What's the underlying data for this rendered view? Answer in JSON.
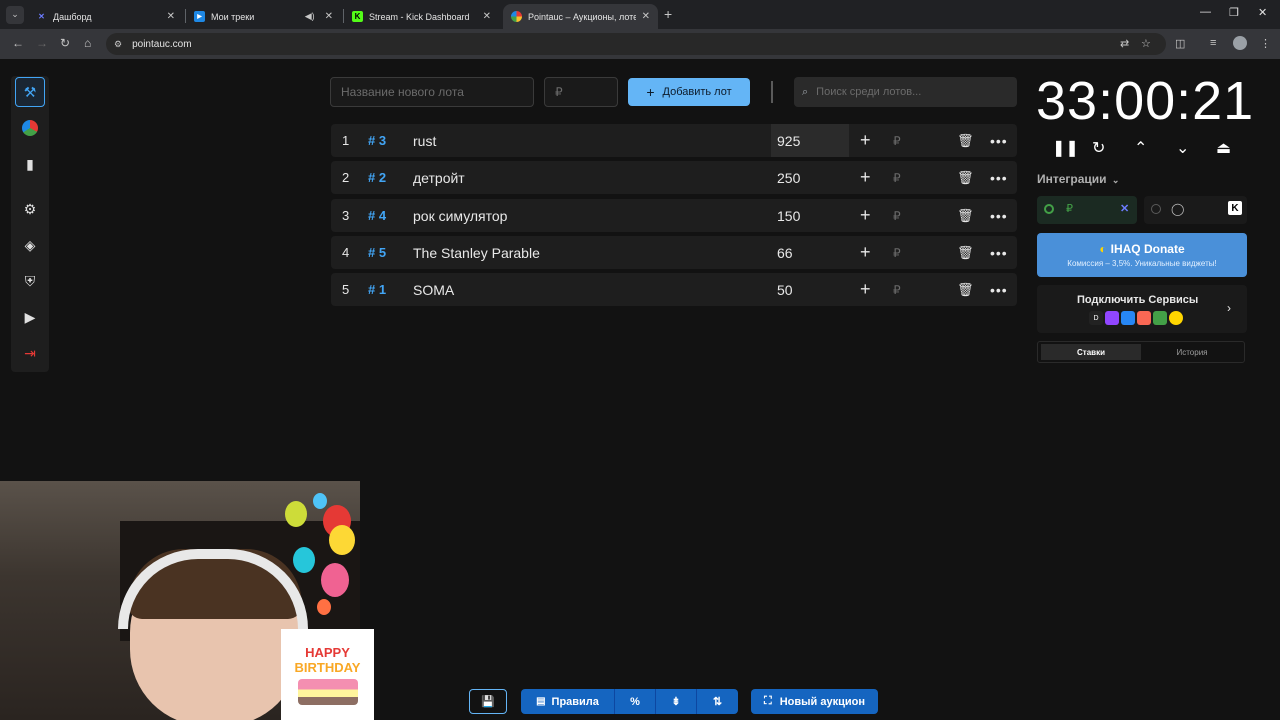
{
  "browser": {
    "tabs": [
      {
        "title": "Дашборд",
        "favicon": "✕",
        "favicon_color": "#6c7cff"
      },
      {
        "title": "Мои треки",
        "favicon": "▶",
        "favicon_color": "#1e88e5",
        "audio": "speaker-icon"
      },
      {
        "title": "Stream - Kick Dashboard",
        "favicon": "K",
        "favicon_color": "#53fc18"
      },
      {
        "title": "Pointauc – Аукционы, лотерея",
        "favicon": "●",
        "favicon_color": "#e53935"
      }
    ],
    "url": "pointauc.com"
  },
  "toolbar": {
    "new_lot_placeholder": "Название нового лота",
    "currency_placeholder": "₽",
    "add_lot_label": "Добавить лот",
    "search_placeholder": "Поиск среди лотов..."
  },
  "lots": [
    {
      "pos": "1",
      "id": "# 3",
      "name": "rust",
      "amount": "925",
      "currency": "₽"
    },
    {
      "pos": "2",
      "id": "# 2",
      "name": "детройт",
      "amount": "250",
      "currency": "₽"
    },
    {
      "pos": "3",
      "id": "# 4",
      "name": "рок симулятор",
      "amount": "150",
      "currency": "₽"
    },
    {
      "pos": "4",
      "id": "# 5",
      "name": " The Stanley Parable",
      "amount": "66",
      "currency": "₽"
    },
    {
      "pos": "5",
      "id": "# 1",
      "name": "SOMA",
      "amount": "50",
      "currency": "₽"
    }
  ],
  "timer": "33:00:21",
  "integrations": {
    "label": "Интеграции",
    "donate_title": "IHAQ Donate",
    "donate_subtitle": "Комиссия – 3,5%. Уникальные виджеты!",
    "services_title": "Подключить Сервисы",
    "currency": "₽"
  },
  "history_tabs": {
    "bids": "Ставки",
    "history": "История"
  },
  "bottom": {
    "rules_label": "Правила",
    "percent_label": "%",
    "new_auction_label": "Новый аукцион"
  },
  "overlay": {
    "happy": "HAPPY",
    "birthday": "BIRTHDAY"
  },
  "colors": {
    "accent": "#42a5f5",
    "primary_button": "#64b5f6",
    "bottom_button": "#1565c0",
    "danger": "#e53935"
  }
}
